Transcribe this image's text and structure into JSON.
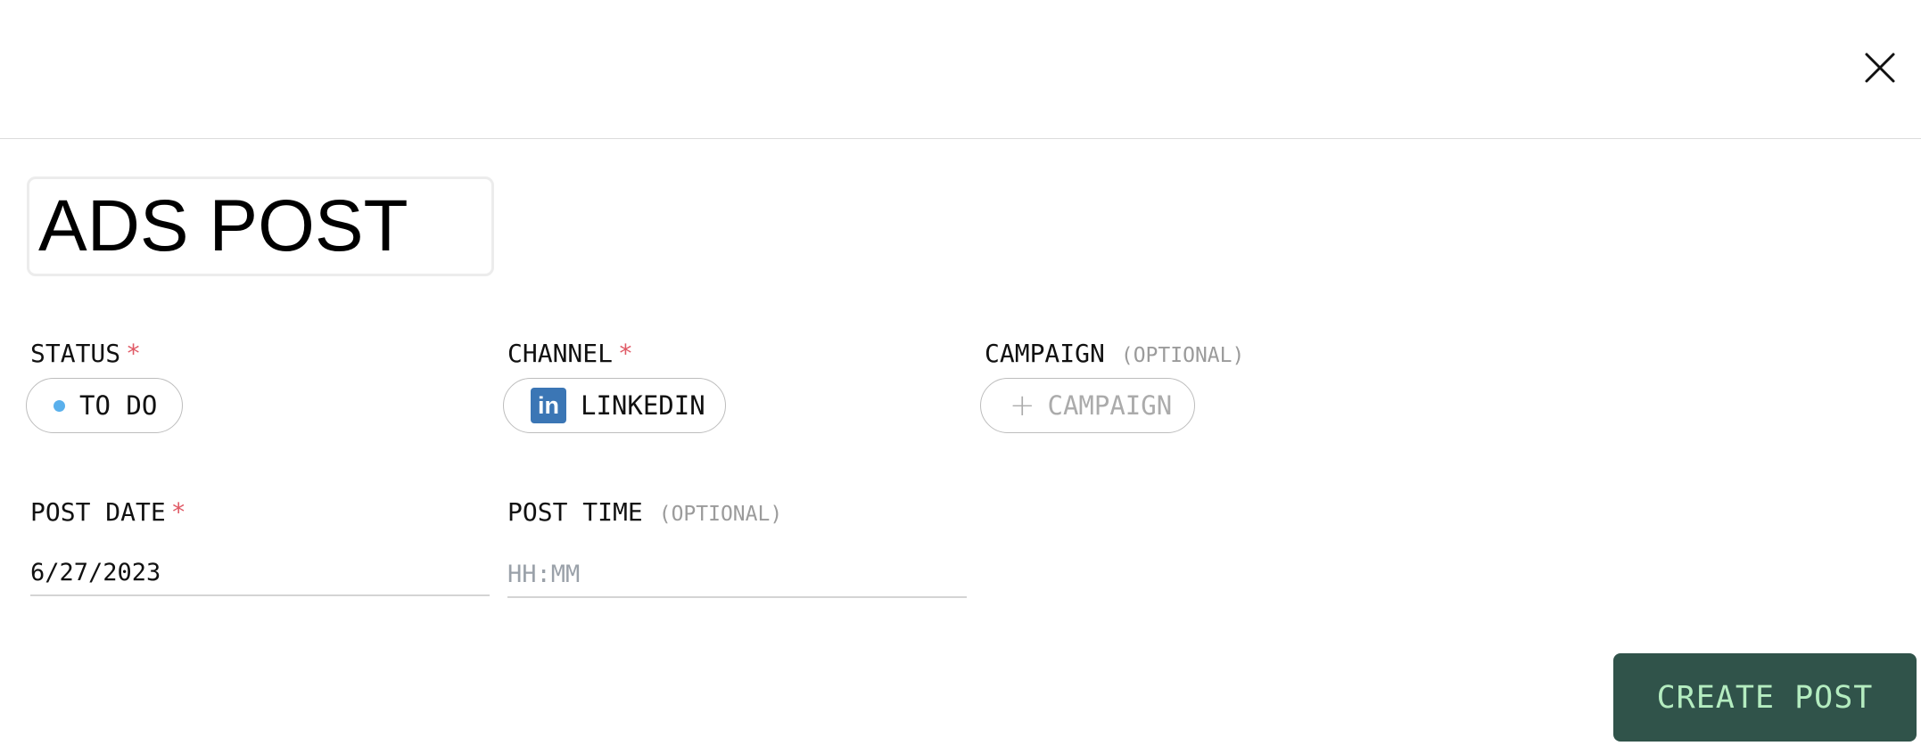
{
  "header": {
    "close_icon": "close-icon"
  },
  "title": {
    "value": "ADS POST"
  },
  "fields": {
    "status": {
      "label": "STATUS",
      "required_mark": "*",
      "value": "TO DO",
      "dot_color": "#5ab0ec"
    },
    "channel": {
      "label": "CHANNEL",
      "required_mark": "*",
      "value": "LINKEDIN",
      "icon": "linkedin-icon",
      "icon_text": "in",
      "icon_color": "#3b76b5"
    },
    "campaign": {
      "label": "CAMPAIGN",
      "optional_text": "(OPTIONAL)",
      "button_label": "CAMPAIGN",
      "plus_glyph": "+"
    },
    "post_date": {
      "label": "POST DATE",
      "required_mark": "*",
      "value": "6/27/2023"
    },
    "post_time": {
      "label": "POST TIME",
      "optional_text": "(OPTIONAL)",
      "placeholder": "HH:MM"
    }
  },
  "actions": {
    "create_label": "CREATE POST",
    "button_color": "#30534a",
    "button_text_color": "#b4ecc0"
  },
  "colors": {
    "required": "#e05a66",
    "optional": "#9b9b9b"
  }
}
